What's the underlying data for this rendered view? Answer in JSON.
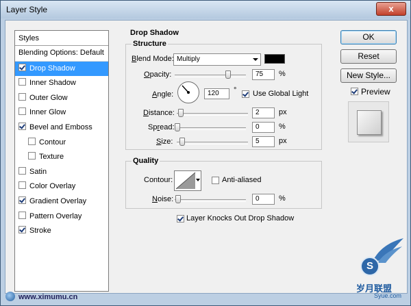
{
  "window": {
    "title": "Layer Style",
    "close_glyph": "x"
  },
  "styles_list": {
    "header": "Styles",
    "items": [
      {
        "label": "Blending Options: Default",
        "has_checkbox": false,
        "checked": false,
        "selected": false,
        "sub": false
      },
      {
        "label": "Drop Shadow",
        "has_checkbox": true,
        "checked": true,
        "selected": true,
        "sub": false
      },
      {
        "label": "Inner Shadow",
        "has_checkbox": true,
        "checked": false,
        "selected": false,
        "sub": false
      },
      {
        "label": "Outer Glow",
        "has_checkbox": true,
        "checked": false,
        "selected": false,
        "sub": false
      },
      {
        "label": "Inner Glow",
        "has_checkbox": true,
        "checked": false,
        "selected": false,
        "sub": false
      },
      {
        "label": "Bevel and Emboss",
        "has_checkbox": true,
        "checked": true,
        "selected": false,
        "sub": false
      },
      {
        "label": "Contour",
        "has_checkbox": true,
        "checked": false,
        "selected": false,
        "sub": true
      },
      {
        "label": "Texture",
        "has_checkbox": true,
        "checked": false,
        "selected": false,
        "sub": true
      },
      {
        "label": "Satin",
        "has_checkbox": true,
        "checked": false,
        "selected": false,
        "sub": false
      },
      {
        "label": "Color Overlay",
        "has_checkbox": true,
        "checked": false,
        "selected": false,
        "sub": false
      },
      {
        "label": "Gradient Overlay",
        "has_checkbox": true,
        "checked": true,
        "selected": false,
        "sub": false
      },
      {
        "label": "Pattern Overlay",
        "has_checkbox": true,
        "checked": false,
        "selected": false,
        "sub": false
      },
      {
        "label": "Stroke",
        "has_checkbox": true,
        "checked": true,
        "selected": false,
        "sub": false
      }
    ]
  },
  "drop_shadow": {
    "section_title": "Drop Shadow",
    "structure": {
      "title": "Structure",
      "blend_mode_label": "Blend Mode:",
      "blend_mode_value": "Multiply",
      "shadow_color": "#000000",
      "opacity_label": "Opacity:",
      "opacity_value": "75",
      "opacity_unit": "%",
      "opacity_fraction": 0.75,
      "angle_label": "Angle:",
      "angle_value": "120",
      "angle_unit": "°",
      "use_global_light_label": "Use Global Light",
      "use_global_light_checked": true,
      "distance_label": "Distance:",
      "distance_value": "2",
      "distance_unit": "px",
      "spread_label": "Spread:",
      "spread_value": "0",
      "spread_unit": "%",
      "size_label": "Size:",
      "size_value": "5",
      "size_unit": "px"
    },
    "quality": {
      "title": "Quality",
      "contour_label": "Contour:",
      "anti_aliased_label": "Anti-aliased",
      "anti_aliased_checked": false,
      "noise_label": "Noise:",
      "noise_value": "0",
      "noise_unit": "%"
    },
    "layer_knocks_out_label": "Layer Knocks Out Drop Shadow",
    "layer_knocks_out_checked": true
  },
  "buttons": {
    "ok": "OK",
    "reset": "Reset",
    "new_style": "New Style...",
    "preview_label": "Preview",
    "preview_checked": true
  },
  "watermark": {
    "url": "www.ximumu.cn",
    "logo_letter": "S",
    "logo_text": "岁月联盟",
    "logo_sub": "Syue.com"
  },
  "colors": {
    "selection": "#3399ff",
    "window_frame": "#bccfe3",
    "dialog_bg": "#f0f0f0"
  }
}
